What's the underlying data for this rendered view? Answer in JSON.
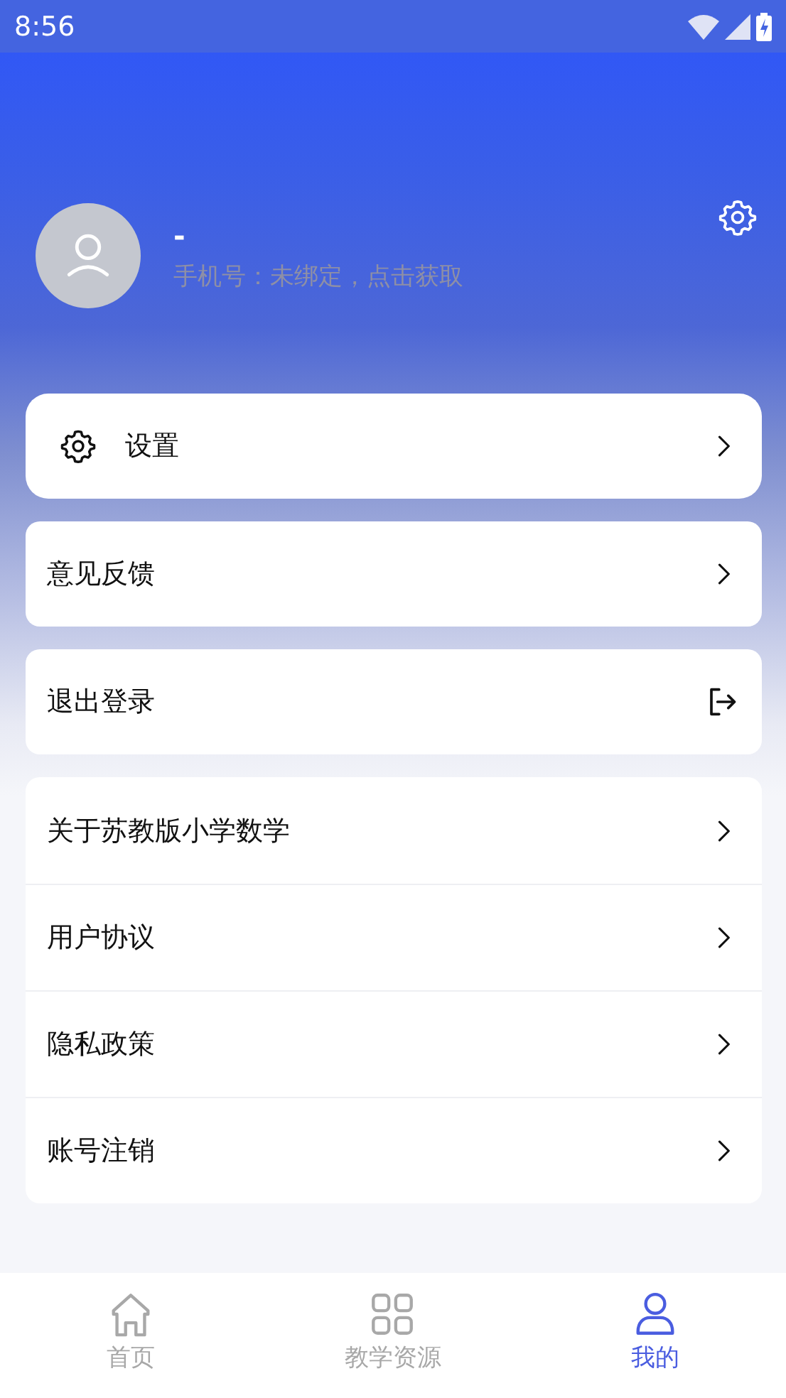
{
  "status_bar": {
    "time": "8:56"
  },
  "profile": {
    "name": "-",
    "phone": "手机号：未绑定，点击获取"
  },
  "menu_cards": [
    {
      "label": "设置",
      "kind": "settings"
    },
    {
      "label": "意见反馈",
      "kind": "link"
    },
    {
      "label": "退出登录",
      "kind": "logout"
    }
  ],
  "info_list": [
    {
      "label": "关于苏教版小学数学"
    },
    {
      "label": "用户协议"
    },
    {
      "label": "隐私政策"
    },
    {
      "label": "账号注销"
    }
  ],
  "tabs": [
    {
      "label": "首页",
      "kind": "home",
      "selected": false
    },
    {
      "label": "教学资源",
      "kind": "grid",
      "selected": false
    },
    {
      "label": "我的",
      "kind": "person",
      "selected": true
    }
  ]
}
